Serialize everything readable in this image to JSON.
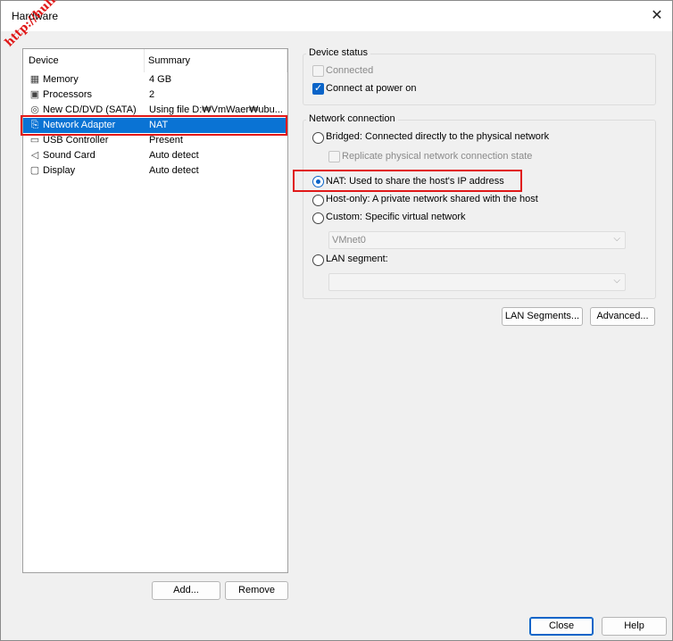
{
  "window": {
    "title": "Hardware",
    "close_glyph": "✕"
  },
  "watermark": "http://hulkr",
  "device_list": {
    "headers": {
      "device": "Device",
      "summary": "Summary"
    },
    "rows": [
      {
        "icon": "memory-icon",
        "glyph": "▦",
        "name": "Memory",
        "summary": "4 GB"
      },
      {
        "icon": "processor-icon",
        "glyph": "▣",
        "name": "Processors",
        "summary": "2"
      },
      {
        "icon": "cd-dvd-icon",
        "glyph": "◎",
        "name": "New CD/DVD (SATA)",
        "summary": "Using file D:₩VmWaer₩ubu..."
      },
      {
        "icon": "network-adapter-icon",
        "glyph": "⎘",
        "name": "Network Adapter",
        "summary": "NAT"
      },
      {
        "icon": "usb-icon",
        "glyph": "▭",
        "name": "USB Controller",
        "summary": "Present"
      },
      {
        "icon": "sound-card-icon",
        "glyph": "◁",
        "name": "Sound Card",
        "summary": "Auto detect"
      },
      {
        "icon": "display-icon",
        "glyph": "▢",
        "name": "Display",
        "summary": "Auto detect"
      }
    ],
    "selected_index": 3
  },
  "buttons": {
    "add": "Add...",
    "remove": "Remove",
    "lan_segments": "LAN Segments...",
    "advanced": "Advanced...",
    "close": "Close",
    "help": "Help"
  },
  "device_status": {
    "title": "Device status",
    "connected": {
      "label": "Connected",
      "checked": false,
      "enabled": false
    },
    "connect_at_power_on": {
      "label": "Connect at power on",
      "checked": true
    }
  },
  "network_connection": {
    "title": "Network connection",
    "bridged": "Bridged: Connected directly to the physical network",
    "replicate": "Replicate physical network connection state",
    "nat": "NAT: Used to share the host's IP address",
    "host_only": "Host-only: A private network shared with the host",
    "custom": "Custom: Specific virtual network",
    "custom_value": "VMnet0",
    "lan_segment": "LAN segment:",
    "lan_segment_value": "",
    "selected": "nat"
  },
  "colors": {
    "selection": "#0a73d4",
    "highlight_box": "#e01818",
    "accent": "#0a64c8"
  }
}
